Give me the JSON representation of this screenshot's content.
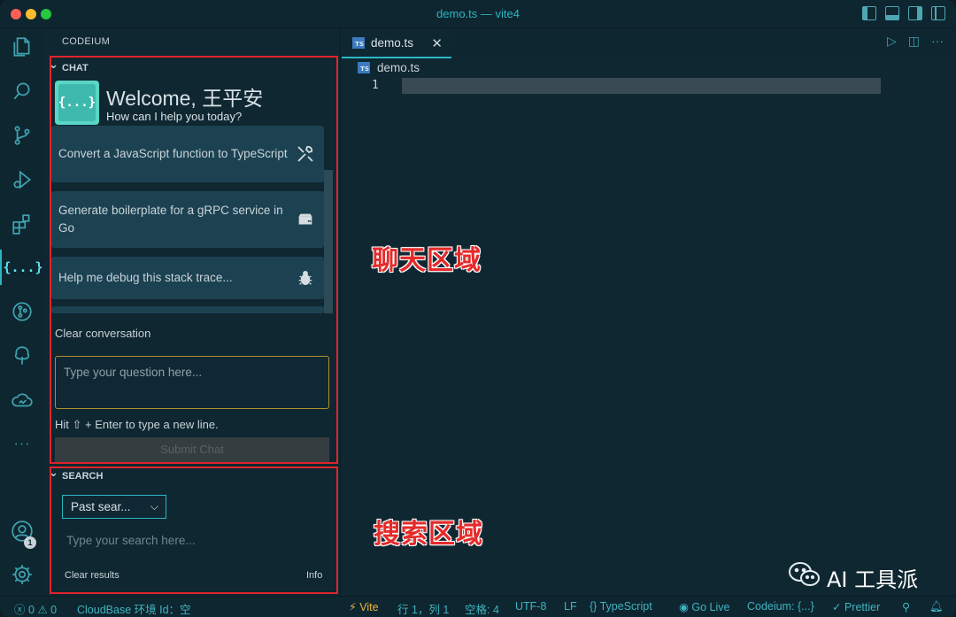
{
  "window": {
    "title": "demo.ts — vite4"
  },
  "activity_bar": {
    "items": [
      "explorer-icon",
      "search-icon",
      "source-control-icon",
      "run-debug-icon",
      "extensions-icon",
      "codeium-icon",
      "git-graph-icon",
      "tree-icon",
      "cloud-icon",
      "more-icon"
    ],
    "codeium_mark": "{...}",
    "more": "···",
    "account_badge": "1"
  },
  "sidebar": {
    "title": "CODEIUM",
    "chat": {
      "header": "CHAT",
      "logo": "{...}",
      "welcome": "Welcome, 王平安",
      "subtitle": "How can I help you today?",
      "suggestions": [
        {
          "label": "Convert a JavaScript function to TypeScript",
          "icon": "wrench-screwdriver-icon"
        },
        {
          "label": "Generate boilerplate for a gRPC service in Go",
          "icon": "server-icon"
        },
        {
          "label": "Help me debug this stack trace...",
          "icon": "bug-icon"
        }
      ],
      "clear_label": "Clear conversation",
      "input_placeholder": "Type your question here...",
      "hint": "Hit ⇧ + Enter to type a new line.",
      "submit_label": "Submit Chat"
    },
    "search": {
      "header": "SEARCH",
      "select_value": "Past sear...",
      "input_placeholder": "Type your search here...",
      "clear_results": "Clear results",
      "info": "Info"
    }
  },
  "editor": {
    "tab_label": "demo.ts",
    "tab_icon_text": "TS",
    "breadcrumb": "demo.ts",
    "line_numbers": [
      "1"
    ]
  },
  "annotations": {
    "chat_area": "聊天区域",
    "search_area": "搜索区域"
  },
  "watermark": "AI 工具派",
  "status_bar": {
    "errors": "0",
    "warnings": "0",
    "cloudbase": "CloudBase 环境 Id：空",
    "vite": "Vite",
    "position": "行 1，列 1",
    "spaces": "空格: 4",
    "encoding": "UTF-8",
    "eol": "LF",
    "language": "TypeScript",
    "go_live": "Go Live",
    "codeium": "Codeium: {...}",
    "prettier": "Prettier"
  },
  "colors": {
    "accent": "#2ab7c4",
    "annotation_red": "#e0242b",
    "card_bg": "#1c4252",
    "input_border": "#b18d2e"
  }
}
